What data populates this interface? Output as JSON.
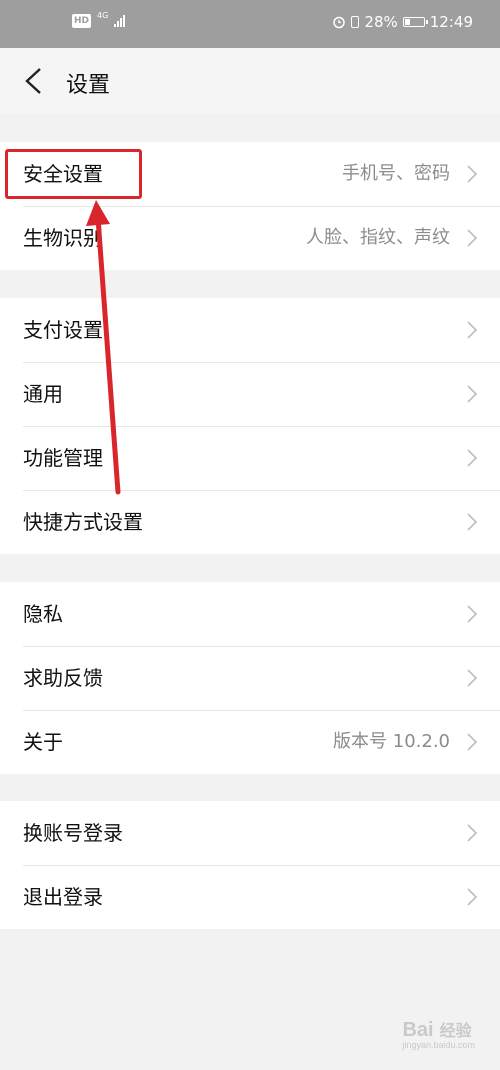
{
  "status_bar": {
    "hd": "HD",
    "network": "4G",
    "battery_percent": "28%",
    "battery_level": 0.28,
    "time": "12:49",
    "alarm_icon": "alarm-clock-icon"
  },
  "header": {
    "title": "设置",
    "back_icon": "chevron-left-icon"
  },
  "groups": [
    {
      "items": [
        {
          "label": "安全设置",
          "value": "手机号、密码"
        },
        {
          "label": "生物识别",
          "value": "人脸、指纹、声纹"
        }
      ]
    },
    {
      "items": [
        {
          "label": "支付设置",
          "value": ""
        },
        {
          "label": "通用",
          "value": ""
        },
        {
          "label": "功能管理",
          "value": ""
        },
        {
          "label": "快捷方式设置",
          "value": ""
        }
      ]
    },
    {
      "items": [
        {
          "label": "隐私",
          "value": ""
        },
        {
          "label": "求助反馈",
          "value": ""
        },
        {
          "label": "关于",
          "value": "版本号 10.2.0"
        }
      ]
    },
    {
      "items": [
        {
          "label": "换账号登录",
          "value": ""
        },
        {
          "label": "退出登录",
          "value": ""
        }
      ]
    }
  ],
  "annotation": {
    "color": "#d9262c"
  },
  "watermark": {
    "text": "Bai",
    "text2": "经验",
    "sub": "jingyan.baidu.com"
  }
}
